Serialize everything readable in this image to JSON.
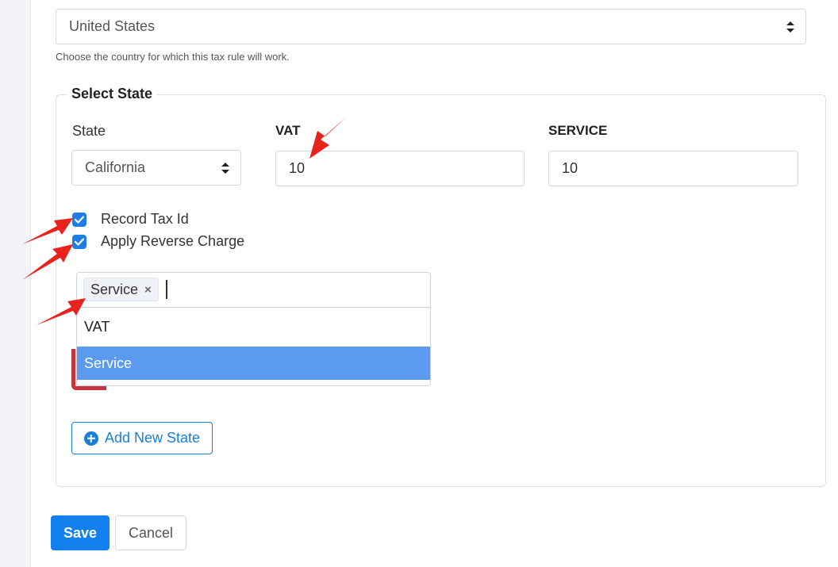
{
  "country": {
    "value": "United States",
    "help": "Choose the country for which this tax rule will work."
  },
  "state_section": {
    "legend": "Select State",
    "state_label": "State",
    "state_value": "California",
    "vat_label": "VAT",
    "vat_value": "10",
    "service_label": "SERVICE",
    "service_value": "10"
  },
  "checkboxes": [
    {
      "label": "Record Tax Id",
      "checked": true
    },
    {
      "label": "Apply Reverse Charge",
      "checked": true
    }
  ],
  "multiselect": {
    "tag": "Service",
    "options": [
      "VAT",
      "Service"
    ],
    "selected": "Service"
  },
  "buttons": {
    "add_state": "Add New State",
    "save": "Save",
    "cancel": "Cancel"
  },
  "colors": {
    "accent": "#1280ee",
    "highlight": "#5b9bef",
    "arrow": "#e8231d"
  }
}
